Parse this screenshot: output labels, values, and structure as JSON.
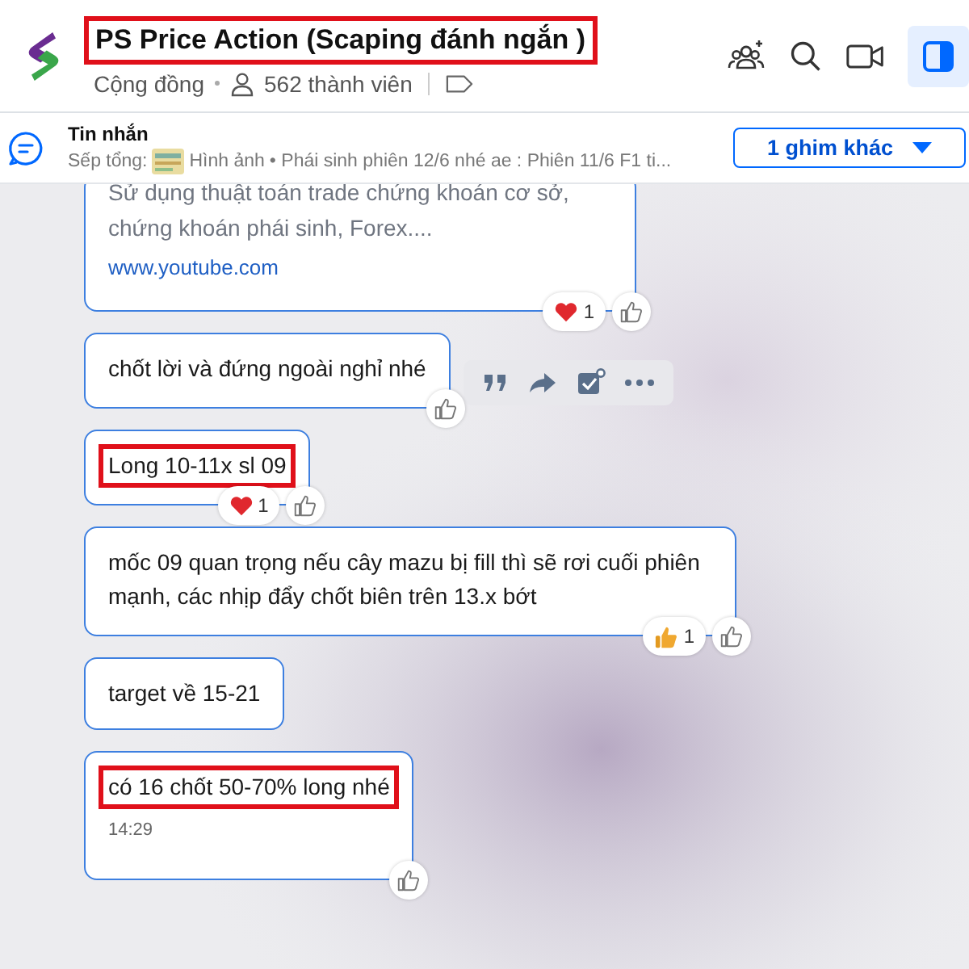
{
  "header": {
    "title": "PS Price Action (Scaping đánh ngắn )",
    "title_highlighted": true,
    "type": "Cộng đồng",
    "members": "562 thành viên",
    "panel_toggle_on": true
  },
  "pinned": {
    "label": "Tin nhắn",
    "sender": "Sếp tổng:",
    "attachment": "Hình ảnh",
    "preview": "• Phái sinh phiên 12/6 nhé ae : Phiên 11/6 F1 ti...",
    "more_button": "1 ghim khác"
  },
  "messages": [
    {
      "kind": "link",
      "text": "Sử dụng thuật toán trade chứng khoán cơ sở, chứng khoán phái sinh, Forex....",
      "link": "www.youtube.com",
      "reactions": [
        {
          "kind": "heart",
          "count": "1"
        }
      ]
    },
    {
      "kind": "text",
      "text": "chốt lời và đứng ngoài nghỉ nhé",
      "hovered": true
    },
    {
      "kind": "text",
      "text": "Long 10-11x sl 09",
      "highlighted": true,
      "reactions": [
        {
          "kind": "heart",
          "count": "1"
        }
      ]
    },
    {
      "kind": "text",
      "text": "mốc 09 quan trọng nếu cây mazu bị fill thì sẽ rơi cuối phiên mạnh, các nhịp đẩy chốt biên trên 13.x bớt",
      "reactions": [
        {
          "kind": "thumbs",
          "count": "1"
        }
      ]
    },
    {
      "kind": "text",
      "text": "target về 15-21",
      "like": false
    },
    {
      "kind": "text",
      "text": "có 16 chốt 50-70% long nhé",
      "highlighted": true,
      "time": "14:29"
    }
  ]
}
